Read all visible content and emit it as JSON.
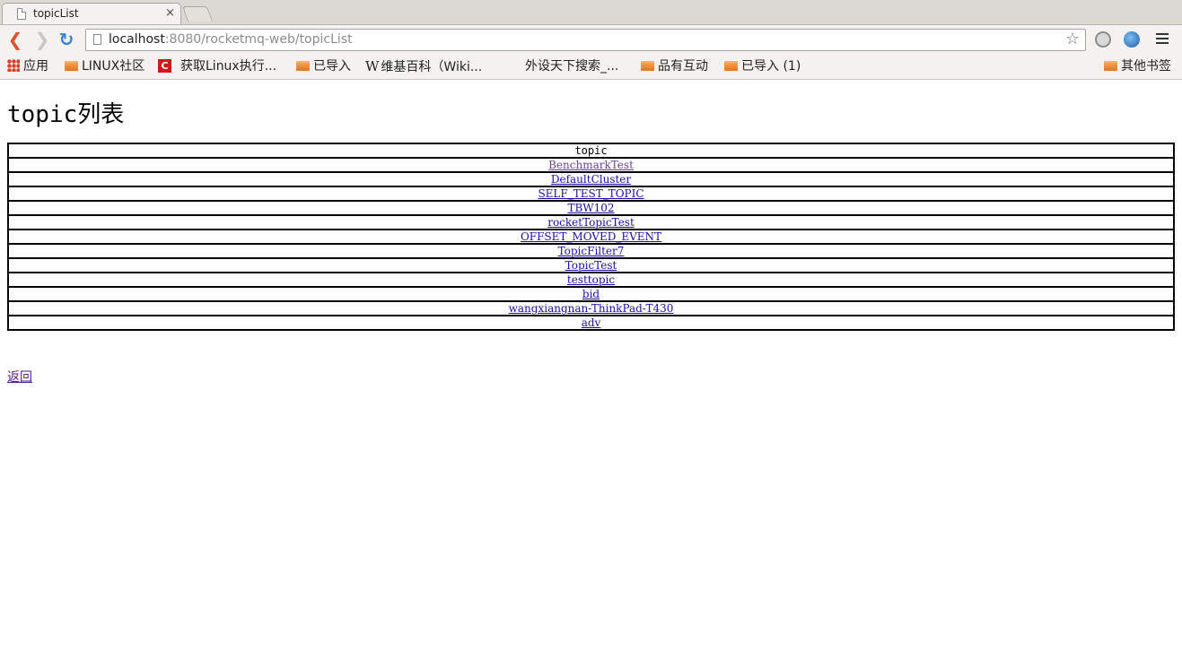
{
  "browser": {
    "tab_title": "topicList",
    "tab_close": "×",
    "url_host": "localhost",
    "url_rest": ":8080/rocketmq-web/topicList",
    "back_glyph": "❮",
    "forward_glyph": "❯",
    "reload_glyph": "↻",
    "star_glyph": "☆"
  },
  "bookmarks": {
    "items": [
      {
        "label": "应用",
        "icon": "apps-icon"
      },
      {
        "label": "LINUX社区",
        "icon": "folder-icon"
      },
      {
        "label": "获取Linux执行...",
        "icon": "c-logo-icon"
      },
      {
        "label": "已导入",
        "icon": "folder-icon"
      },
      {
        "label": "维基百科（Wiki...",
        "icon": "wikipedia-icon"
      },
      {
        "label": "外设天下搜索_...",
        "icon": "blank-page-icon"
      },
      {
        "label": "品有互动",
        "icon": "folder-icon"
      },
      {
        "label": "已导入 (1)",
        "icon": "folder-icon"
      }
    ],
    "other": "其他书签",
    "c_logo_text": "C",
    "wiki_logo_text": "W"
  },
  "page": {
    "heading": "topic列表",
    "table_header": "topic",
    "topics": [
      "BenchmarkTest",
      "DefaultCluster",
      "SELF_TEST_TOPIC",
      "TBW102",
      "rocketTopicTest",
      "OFFSET_MOVED_EVENT",
      "TopicFilter7",
      "TopicTest",
      "testtopic",
      "bid",
      "wangxiangnan-ThinkPad-T430",
      "adv"
    ],
    "back_link": "返回"
  }
}
